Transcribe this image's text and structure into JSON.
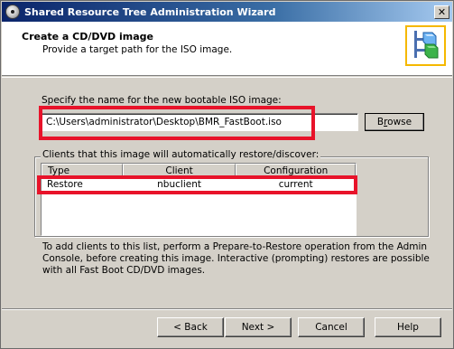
{
  "window": {
    "title": "Shared Resource Tree Administration Wizard",
    "close_glyph": "✕"
  },
  "header": {
    "title": "Create a CD/DVD image",
    "subtitle": "Provide a target path for the ISO image.",
    "logo_icon": "shared-resource-tree-icon"
  },
  "iso": {
    "label": "Specify the name for the new bootable ISO image:",
    "value": "C:\\Users\\administrator\\Desktop\\BMR_FastBoot.iso",
    "browse_label": "Browse",
    "browse_mnemonic": "r"
  },
  "clients": {
    "group_label": "Clients that this image will automatically restore/discover:",
    "columns": [
      "Type",
      "Client",
      "Configuration"
    ],
    "rows": [
      {
        "type": "Restore",
        "client": "nbuclient",
        "configuration": "current"
      }
    ]
  },
  "note": "To add clients to this list, perform a Prepare-to-Restore operation from the Admin Console, before creating this image.  Interactive (prompting) restores are possible with all Fast Boot CD/DVD images.",
  "buttons": {
    "back": "< Back",
    "next": "Next >",
    "cancel": "Cancel",
    "help": "Help"
  },
  "colors": {
    "highlight": "#e8132a",
    "logo_border": "#f5b800",
    "dialog_bg": "#d4d0c8"
  }
}
